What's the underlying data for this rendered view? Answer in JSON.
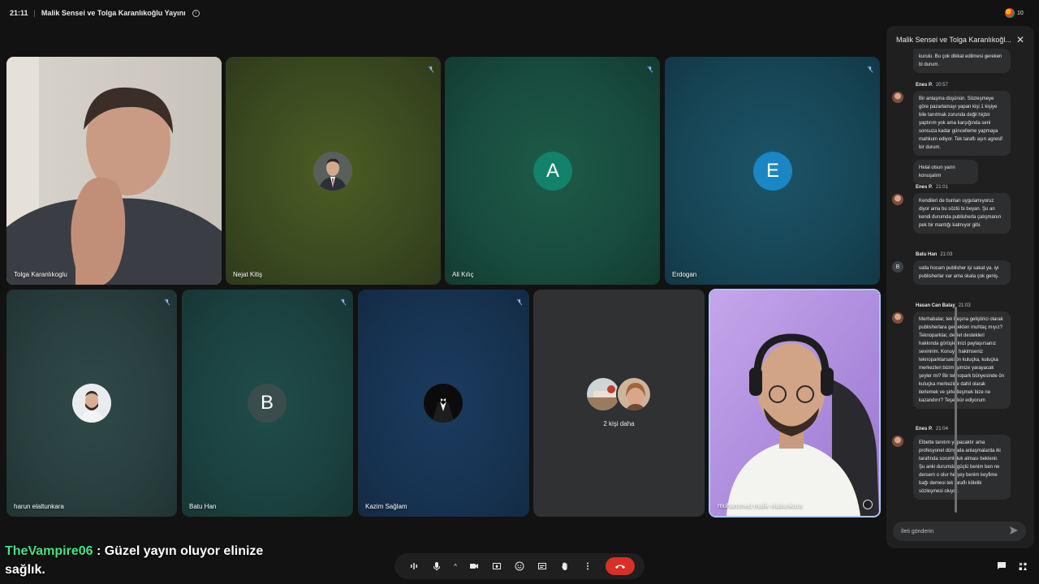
{
  "topbar": {
    "time": "21:11",
    "separator": "|",
    "meeting_title": "Malik Sensei ve Tolga Karanlıkoğlu Yayını",
    "info_icon": "info-icon"
  },
  "participants_count": "10",
  "tiles": {
    "tolga": "Tolga Karanlıkoglu",
    "nejat": "Nejat Kitiş",
    "ali": "Ali Kılıç",
    "ali_letter": "A",
    "erdogan": "Erdogan",
    "erdogan_letter": "E",
    "harun": "harun elaltunkara",
    "batu": "Batu Han",
    "batu_letter": "B",
    "kazim": "Kazim Sağlam",
    "more": "2 kişi daha",
    "muhammed": "muhammed malik elaltunkara"
  },
  "chat": {
    "title": "Malik Sensei ve Tolga Karanlıkoğl...",
    "input_placeholder": "İleti gönderin",
    "messages": [
      {
        "text": "kurulu. Bu çok dikkat edilmesi gereken bi durum."
      },
      {
        "sender": "Enes P.",
        "time": "20:57",
        "text": "Bir anlaşma düşünün. Sözleşmeye göre pazarlamayı yapan kişi 1 kişiye bile tanıtmak zorunda değil hiçbir yaptırım yok ama karşığında seni sonsuza kadar güncelleme yapmaya mahkum ediyor. Tek taraflı aşırı agresif bir durum."
      },
      {
        "text": "Helal olsun yarın konuşalım"
      },
      {
        "sender": "Enes P.",
        "time": "21:01",
        "text": "Kendileri de bunları uygulamıyoruz diyor ama bu sözlü bi beyan. Şu an kendi durumda publisherla çalışmanın pek bir mantığı kalmıyor gibi."
      },
      {
        "sender": "Batu Han",
        "time": "21:03",
        "avatar_letter": "B",
        "text": "valla hocam publisher işi sakat ya. iyi publisherlar var ama skala çok geniş."
      },
      {
        "sender": "Hasan Can Balay",
        "time": "21:03",
        "text": "Merhabalar, tek başına geliştirici olarak publisherlara gerçekten muhtaç mıyız? Teknoparklar, devlet destekleri hakkında görüşlerinizi paylaşırsanız sevinirim. Konuya hakimseniz teknoparklarsaki ön kuluçka, kuluçka merkezleri bizim işimize yarayacak şeyler mi? Bir teknopark bünyesinde ön kuluçka merkezine dahil olarak ilerlemek ve şirketleşmek bize ne kazandırır? Teşekkür ediyorum"
      },
      {
        "sender": "Enes P.",
        "time": "21:04",
        "text": "Elbette tanıtım yapacaktır ama profesyonel dünyada anlaşmalarda iki tarafında sorumluluk alması beklenir. Şu anki durumda güçlü benim ben ne dersem o olur herşey benim keyfime bağı demesi tek taraflı kölelik sözleşmesi oluyor."
      }
    ]
  },
  "overlay": {
    "username": "TheVampire06",
    "message": " : Güzel yayın oluyor elinize sağlık."
  },
  "colors": {
    "ali_avatar": "#12826a",
    "erdogan_avatar": "#1a86c4",
    "batu_avatar": "#3a4d4c",
    "end_call": "#d93025",
    "chat_username": "#3ee686"
  }
}
